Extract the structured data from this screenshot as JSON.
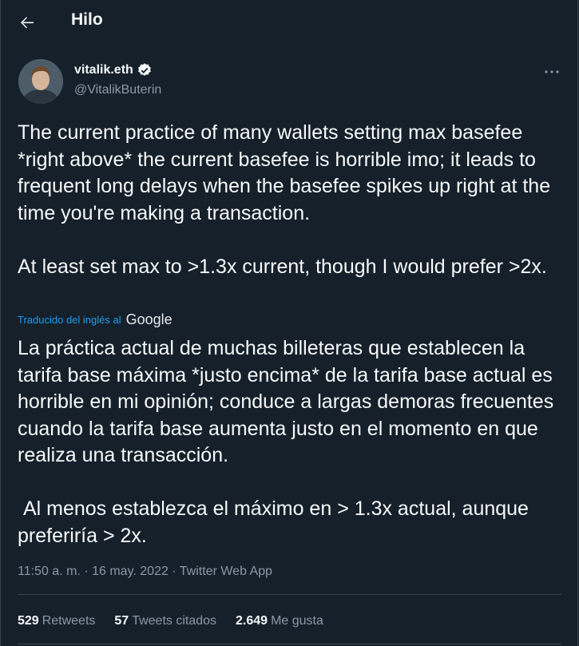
{
  "header": {
    "title": "Hilo"
  },
  "author": {
    "name": "vitalik.eth",
    "handle": "@VitalikButerin"
  },
  "tweet": {
    "text": "The current practice of many wallets setting max basefee *right above* the current basefee is horrible imo; it leads to frequent long delays when the basefee spikes up right at the time you're making a transaction.\n\nAt least set max to >1.3x current, though I would prefer >2x.",
    "translated_label": "Traducido del inglés al",
    "translator": "Google",
    "translation": "La práctica actual de muchas billeteras que establecen la tarifa base máxima *justo encima* de la tarifa base actual es horrible en mi opinión; conduce a largas demoras frecuentes cuando la tarifa base aumenta justo en el momento en que realiza una transacción.\n\n Al menos establezca el máximo en > 1.3x actual, aunque preferiría > 2x."
  },
  "meta": {
    "time": "11:50 a. m.",
    "dot1": "·",
    "date": "16 may. 2022",
    "dot2": "·",
    "source": "Twitter Web App"
  },
  "stats": {
    "retweets_count": "529",
    "retweets_label": "Retweets",
    "quotes_count": "57",
    "quotes_label": "Tweets citados",
    "likes_count": "2.649",
    "likes_label": "Me gusta"
  },
  "colors": {
    "background": "#15202b",
    "accent": "#1d9bf0",
    "secondary_text": "#8b98a5",
    "border": "#38444d"
  },
  "icons": {
    "back": "arrow-left-icon",
    "verified": "verified-badge-icon",
    "more": "more-dots-icon"
  }
}
